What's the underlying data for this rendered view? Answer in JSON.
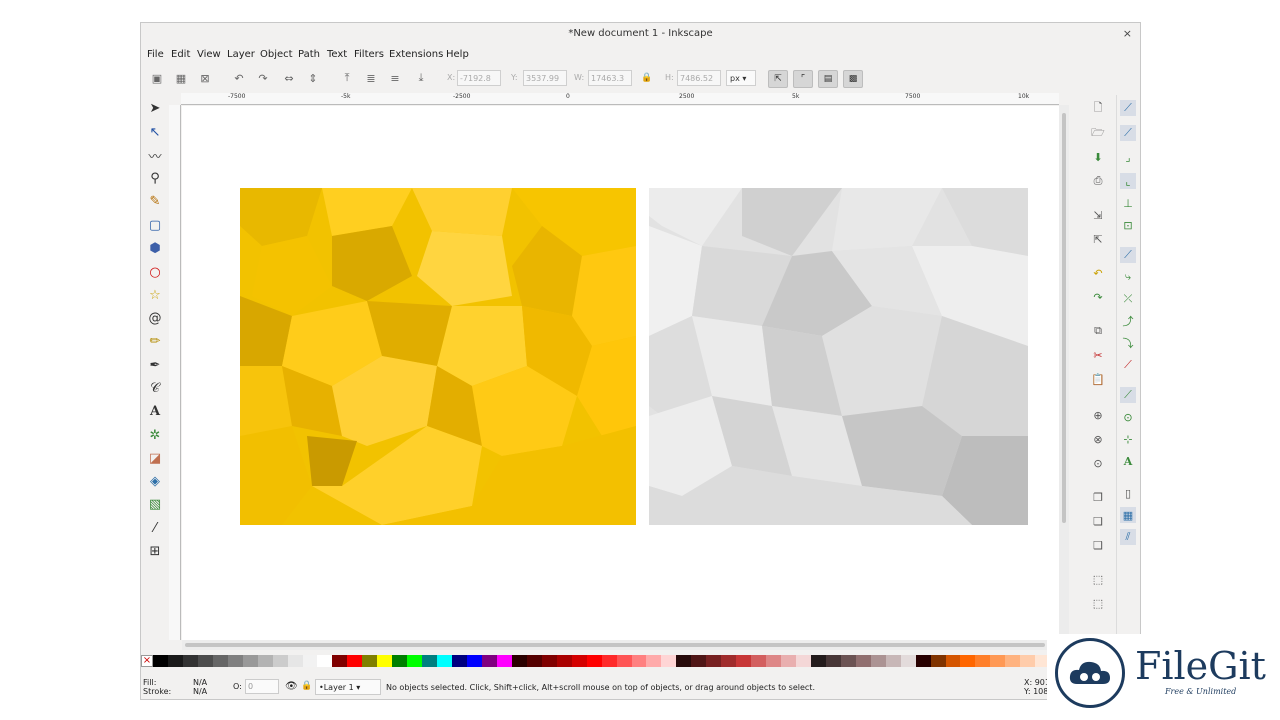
{
  "window": {
    "title": "*New document 1 - Inkscape",
    "close_glyph": "×"
  },
  "menu": [
    "File",
    "Edit",
    "View",
    "Layer",
    "Object",
    "Path",
    "Text",
    "Filters",
    "Extensions",
    "Help"
  ],
  "toolbar": {
    "x_label": "X:",
    "x_value": "-7192.8",
    "y_label": "Y:",
    "y_value": "3537.99",
    "w_label": "W:",
    "w_value": "17463.3",
    "h_label": "H:",
    "h_value": "7486.52",
    "unit": "px"
  },
  "rulers": {
    "top": [
      "-7500",
      "-5k",
      "-2500",
      "0",
      "2500",
      "5k",
      "7500",
      "10k"
    ]
  },
  "tools": [
    "selector-icon",
    "node-icon",
    "tweak-icon",
    "zoom-icon",
    "measure-icon",
    "rect-icon",
    "3dbox-icon",
    "ellipse-icon",
    "star-icon",
    "spiral-icon",
    "pencil-icon",
    "pen-icon",
    "calligraphy-icon",
    "text-icon",
    "spray-icon",
    "eraser-icon",
    "bucket-icon",
    "gradient-icon",
    "dropper-icon",
    "connector-icon"
  ],
  "canvas_images": {
    "yellow": {
      "name": "yellow-lowpoly-image",
      "base": "#f2c200"
    },
    "gray": {
      "name": "gray-lowpoly-image",
      "base": "#e2e2e2"
    }
  },
  "palette": [
    "#000000",
    "#1a1a1a",
    "#333333",
    "#4d4d4d",
    "#666666",
    "#808080",
    "#999999",
    "#b3b3b3",
    "#cccccc",
    "#e6e6e6",
    "#f2f2f2",
    "#ffffff",
    "#800000",
    "#ff0000",
    "#808000",
    "#ffff00",
    "#008000",
    "#00ff00",
    "#008080",
    "#00ffff",
    "#000080",
    "#0000ff",
    "#800080",
    "#ff00ff",
    "#2b0000",
    "#550000",
    "#800000",
    "#aa0000",
    "#d40000",
    "#ff0000",
    "#ff2a2a",
    "#ff5555",
    "#ff8080",
    "#ffaaaa",
    "#ffd5d5",
    "#280b0b",
    "#501616",
    "#782121",
    "#a02c2c",
    "#c83737",
    "#d35f5f",
    "#de8787",
    "#e9afaf",
    "#f4d7d7",
    "#241c1c",
    "#483737",
    "#6c5353",
    "#916f6f",
    "#ac9393",
    "#c8b7b7",
    "#e3dbdb",
    "#280000",
    "#803300",
    "#d45500",
    "#ff6600",
    "#ff7f2a",
    "#ff9955",
    "#ffb380",
    "#ffccaa",
    "#ffe6d5",
    "#2b1100",
    "#552200",
    "#803300",
    "#aa4400",
    "#d45500",
    "#ff6600"
  ],
  "status": {
    "fill_label": "Fill:",
    "stroke_label": "Stroke:",
    "fill_value": "N/A",
    "stroke_value": "N/A",
    "opacity_label": "O:",
    "opacity_value": "0",
    "layer": "•Layer 1",
    "message": "No objects selected. Click, Shift+click, Alt+scroll mouse on top of objects, or drag around objects to select.",
    "x": "X: 901",
    "y": "Y: 108"
  },
  "watermark": {
    "name": "FileGit",
    "tagline": "Free & Unlimited"
  }
}
